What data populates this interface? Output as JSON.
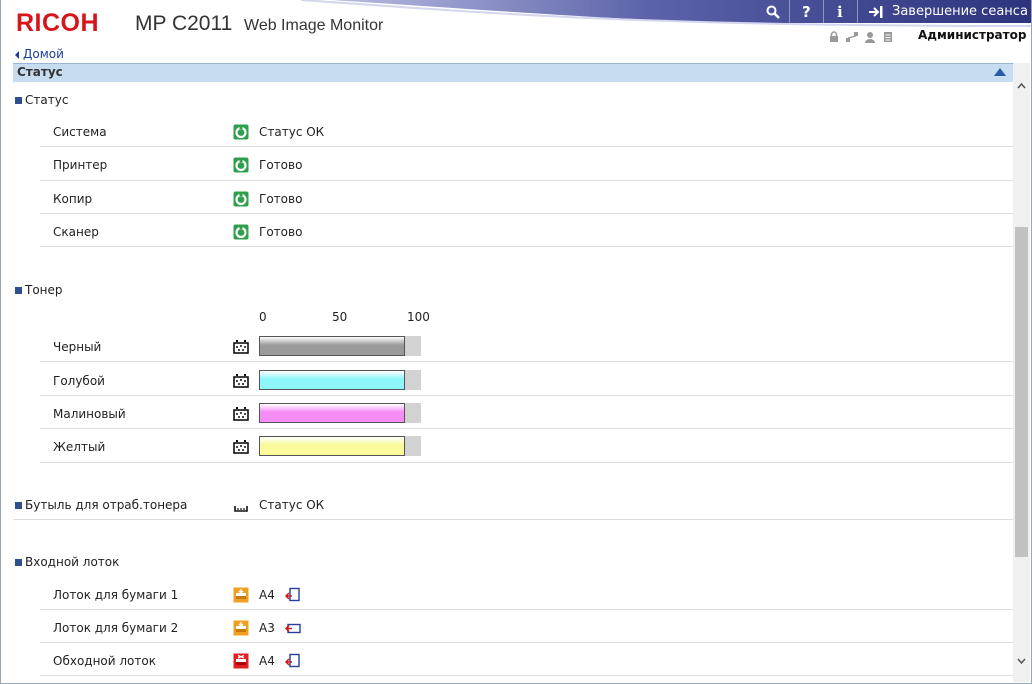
{
  "header": {
    "logo": "RICOH",
    "model": "MP C2011",
    "app_name": "Web Image Monitor",
    "logout_label": "Завершение сеанса",
    "user_label": "Администратор"
  },
  "breadcrumb": {
    "home_label": "Домой"
  },
  "section": {
    "title": "Статус"
  },
  "status_group": {
    "title": "Статус",
    "rows": [
      {
        "label": "Система",
        "value": "Статус ОК"
      },
      {
        "label": "Принтер",
        "value": "Готово"
      },
      {
        "label": "Копир",
        "value": "Готово"
      },
      {
        "label": "Сканер",
        "value": "Готово"
      }
    ]
  },
  "toner_group": {
    "title": "Тонер",
    "scale": [
      "0",
      "50",
      "100"
    ],
    "rows": [
      {
        "label": "Черный",
        "level_percent": 90,
        "color": "#9a9a9a"
      },
      {
        "label": "Голубой",
        "level_percent": 90,
        "color": "#8cf6fa"
      },
      {
        "label": "Малиновый",
        "level_percent": 90,
        "color": "#f68cf6"
      },
      {
        "label": "Желтый",
        "level_percent": 90,
        "color": "#fafa9a"
      }
    ]
  },
  "waste_bottle": {
    "label": "Бутыль для отраб.тонера",
    "value": "Статус ОК"
  },
  "input_tray_group": {
    "title": "Входной лоток",
    "rows": [
      {
        "label": "Лоток для бумаги 1",
        "value": "A4",
        "status_color": "#f0a020"
      },
      {
        "label": "Лоток для бумаги 2",
        "value": "A3",
        "status_color": "#f0a020"
      },
      {
        "label": "Обходной лоток",
        "value": "A4",
        "status_color": "#e02020"
      }
    ]
  }
}
